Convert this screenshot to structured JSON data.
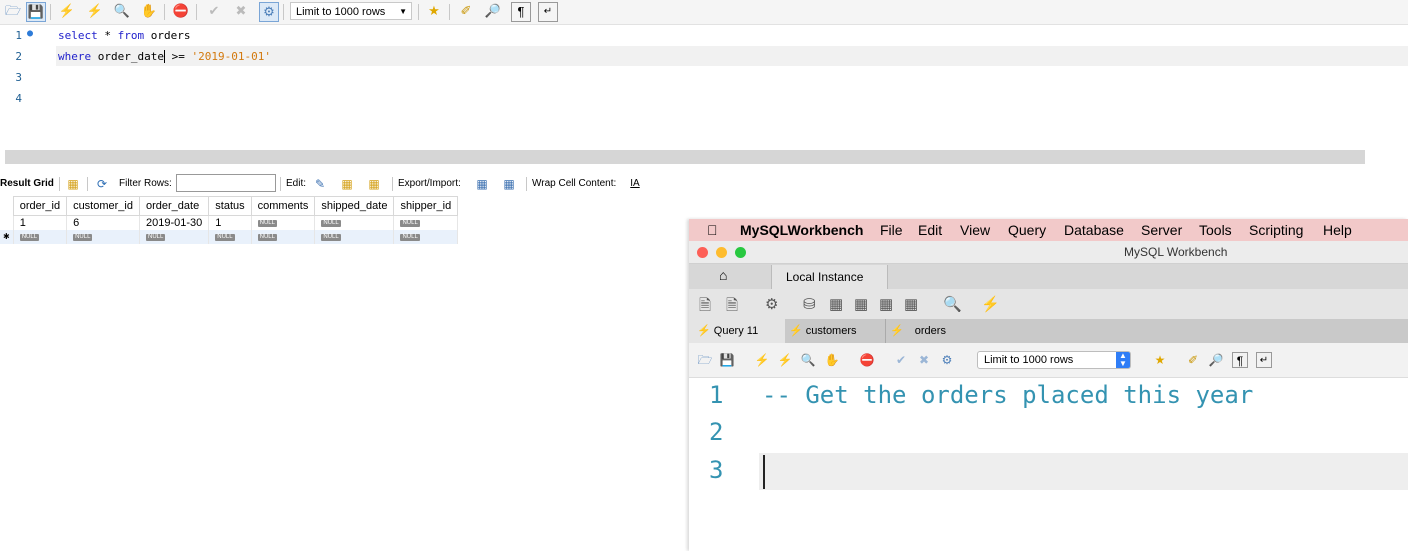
{
  "toolbar": {
    "limit_label": "Limit to 1000 rows",
    "icons": [
      "folder-icon",
      "save-icon",
      "execute-icon",
      "execute-current-icon",
      "explain-icon",
      "stop-icon",
      "toggle-error-icon",
      "commit-icon",
      "rollback-icon",
      "autocommit-icon",
      "beautify-icon",
      "brush-icon",
      "find-icon",
      "invisible-chars-icon",
      "wrap-icon"
    ]
  },
  "editor": {
    "lines": [
      {
        "num": "1",
        "kw1": "select",
        "mid1": " * ",
        "kw2": "from",
        "rest": " orders"
      },
      {
        "num": "2",
        "kw1": "where",
        "mid1": " order_date",
        "rest": " >= ",
        "str": "'2019-01-01'"
      },
      {
        "num": "3"
      },
      {
        "num": "4"
      }
    ]
  },
  "result_toolbar": {
    "result_grid": "Result Grid",
    "filter_rows": "Filter Rows:",
    "edit": "Edit:",
    "export_import": "Export/Import:",
    "wrap_cell": "Wrap Cell Content:"
  },
  "grid": {
    "columns": [
      "order_id",
      "customer_id",
      "order_date",
      "status",
      "comments",
      "shipped_date",
      "shipper_id"
    ],
    "rows": [
      [
        "1",
        "6",
        "2019-01-30",
        "1",
        "NULL",
        "NULL",
        "NULL"
      ],
      [
        "NULL",
        "NULL",
        "NULL",
        "NULL",
        "NULL",
        "NULL",
        "NULL"
      ]
    ]
  },
  "mac": {
    "menu": {
      "app": "MySQLWorkbench",
      "items": [
        "File",
        "Edit",
        "View",
        "Query",
        "Database",
        "Server",
        "Tools",
        "Scripting",
        "Help"
      ]
    },
    "window_title": "MySQL Workbench",
    "instance_tab": "Local Instance",
    "query_tabs": [
      "Query 11",
      "customers",
      "orders"
    ],
    "limit_label": "Limit to 1000 rows",
    "editor_lines": [
      {
        "num": "1",
        "text": "-- Get the orders placed this year"
      },
      {
        "num": "2",
        "text": ""
      },
      {
        "num": "3",
        "text": ""
      }
    ]
  }
}
